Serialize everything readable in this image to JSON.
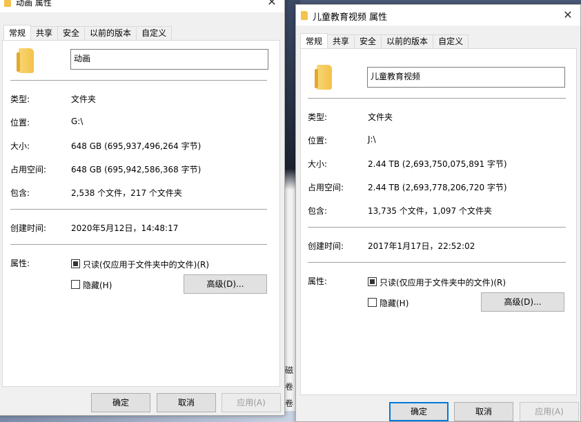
{
  "background": {
    "fragments": [
      "磁",
      "卷",
      "卷",
      "新加"
    ]
  },
  "dialog1": {
    "title": "动画 属性",
    "tabs": [
      "常规",
      "共享",
      "安全",
      "以前的版本",
      "自定义"
    ],
    "name": "动画",
    "labels": {
      "type": "类型:",
      "location": "位置:",
      "size": "大小:",
      "size_on_disk": "占用空间:",
      "contains": "包含:",
      "created": "创建时间:",
      "attributes": "属性:"
    },
    "values": {
      "type": "文件夹",
      "location": "G:\\",
      "size": "648 GB (695,937,496,264 字节)",
      "size_on_disk": "648 GB (695,942,586,368 字节)",
      "contains": "2,538 个文件，217 个文件夹",
      "created": "2020年5月12日，14:48:17"
    },
    "readonly_label": "只读(仅应用于文件夹中的文件)(R)",
    "hidden_label": "隐藏(H)",
    "advanced_button": "高级(D)...",
    "ok_button": "确定",
    "cancel_button": "取消",
    "apply_button": "应用(A)"
  },
  "dialog2": {
    "title": "儿童教育视频 属性",
    "tabs": [
      "常规",
      "共享",
      "安全",
      "以前的版本",
      "自定义"
    ],
    "name": "儿童教育视频",
    "labels": {
      "type": "类型:",
      "location": "位置:",
      "size": "大小:",
      "size_on_disk": "占用空间:",
      "contains": "包含:",
      "created": "创建时间:",
      "attributes": "属性:"
    },
    "values": {
      "type": "文件夹",
      "location": "J:\\",
      "size": "2.44 TB (2,693,750,075,891 字节)",
      "size_on_disk": "2.44 TB (2,693,778,206,720 字节)",
      "contains": "13,735 个文件，1,097 个文件夹",
      "created": "2017年1月17日，22:52:02"
    },
    "readonly_label": "只读(仅应用于文件夹中的文件)(R)",
    "hidden_label": "隐藏(H)",
    "advanced_button": "高级(D)...",
    "ok_button": "确定",
    "cancel_button": "取消",
    "apply_button": "应用(A)"
  }
}
